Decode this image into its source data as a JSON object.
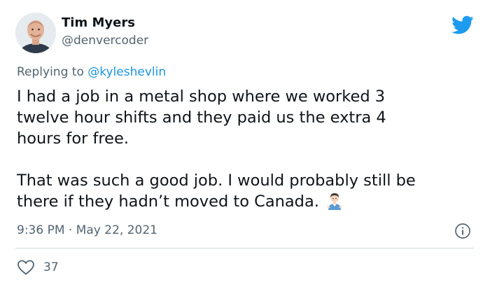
{
  "author": {
    "display_name": "Tim Myers",
    "handle": "@denvercoder"
  },
  "reply": {
    "prefix": "Replying to ",
    "mention": "@kyleshevlin"
  },
  "tweet": {
    "paragraph_1": "I had a job in a metal shop where we worked 3\ntwelve hour shifts and they paid us the extra 4\nhours for free.",
    "paragraph_2": "That was such a good job. I would probably still be\nthere if they hadn’t moved to Canada.",
    "emoji": "man-shrugging"
  },
  "meta": {
    "timestamp": "9:36 PM · May 22, 2021"
  },
  "actions": {
    "like_count": "37"
  },
  "icons": {
    "brand": "twitter-bird-icon",
    "info": "info-icon",
    "like": "heart-icon"
  },
  "colors": {
    "brand": "#1d9bf0",
    "mention": "#1b95e0",
    "secondary_text": "#536471",
    "primary_text": "#0f1419",
    "divider": "#cfd9de"
  }
}
